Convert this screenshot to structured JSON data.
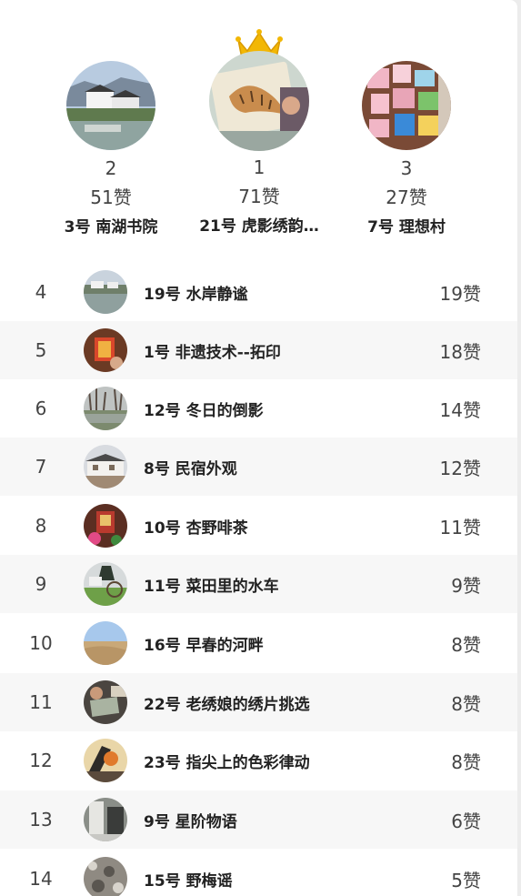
{
  "podium": [
    {
      "rank": "2",
      "likes": "51赞",
      "name": "3号 南湖书院",
      "image": "lakeside-village-photo"
    },
    {
      "rank": "1",
      "likes": "71赞",
      "name": "21号 虎影绣韵…",
      "image": "tiger-embroidery-photo"
    },
    {
      "rank": "3",
      "likes": "27赞",
      "name": "7号 理想村",
      "image": "colorful-wall-photo"
    }
  ],
  "crown_icon": "crown-icon",
  "rows": [
    {
      "rank": "4",
      "name": "19号 水岸静谧",
      "likes": "19赞"
    },
    {
      "rank": "5",
      "name": "1号 非遗技术--拓印",
      "likes": "18赞"
    },
    {
      "rank": "6",
      "name": "12号 冬日的倒影",
      "likes": "14赞"
    },
    {
      "rank": "7",
      "name": "8号 民宿外观",
      "likes": "12赞"
    },
    {
      "rank": "8",
      "name": "10号 杏野啡茶",
      "likes": "11赞"
    },
    {
      "rank": "9",
      "name": "11号 菜田里的水车",
      "likes": "9赞"
    },
    {
      "rank": "10",
      "name": "16号 早春的河畔",
      "likes": "8赞"
    },
    {
      "rank": "11",
      "name": "22号 老绣娘的绣片挑选",
      "likes": "8赞"
    },
    {
      "rank": "12",
      "name": "23号 指尖上的色彩律动",
      "likes": "8赞"
    },
    {
      "rank": "13",
      "name": "9号 星阶物语",
      "likes": "6赞"
    },
    {
      "rank": "14",
      "name": "15号 野梅谣",
      "likes": "5赞"
    }
  ],
  "colors": {
    "crown": "#f2b705",
    "alt_row": "#f7f7f7"
  }
}
